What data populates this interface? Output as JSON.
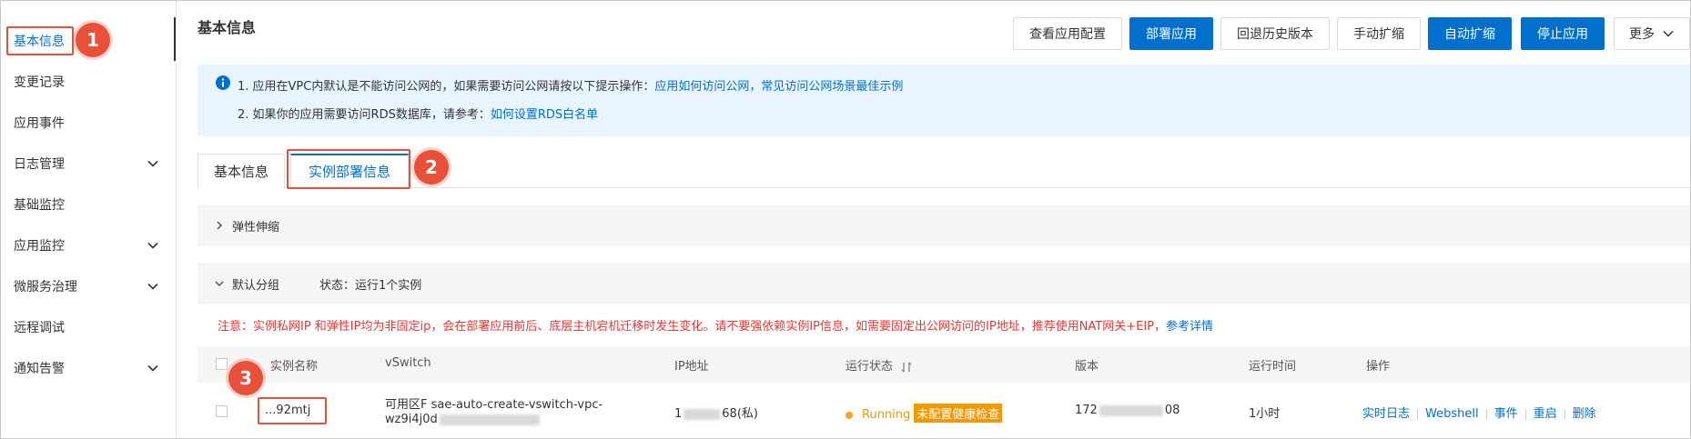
{
  "sidebar": {
    "items": [
      {
        "label": "基本信息",
        "expandable": false,
        "active": true
      },
      {
        "label": "变更记录",
        "expandable": false
      },
      {
        "label": "应用事件",
        "expandable": false
      },
      {
        "label": "日志管理",
        "expandable": true
      },
      {
        "label": "基础监控",
        "expandable": false
      },
      {
        "label": "应用监控",
        "expandable": true
      },
      {
        "label": "微服务治理",
        "expandable": true
      },
      {
        "label": "远程调试",
        "expandable": false
      },
      {
        "label": "通知告警",
        "expandable": true
      }
    ]
  },
  "header": {
    "title": "基本信息",
    "buttons": {
      "view_config": "查看应用配置",
      "deploy": "部署应用",
      "rollback": "回退历史版本",
      "manual_scale": "手动扩缩",
      "auto_scale": "自动扩缩",
      "stop": "停止应用",
      "more": "更多"
    }
  },
  "notice": {
    "line1_prefix": "1. 应用在VPC内默认是不能访问公网的，如果需要访问公网请按以下提示操作：",
    "line1_link1": "应用如何访问公网",
    "line1_sep": "，",
    "line1_link2": "常见访问公网场景最佳示例",
    "line2_prefix": "2. 如果你的应用需要访问RDS数据库，请参考：",
    "line2_link": "如何设置RDS白名单"
  },
  "tabs": [
    "基本信息",
    "实例部署信息"
  ],
  "elastic": {
    "label": "弹性伸缩"
  },
  "group": {
    "name": "默认分组",
    "status": "状态：运行1个实例"
  },
  "warning": {
    "text": "注意：实例私网IP 和弹性IP均为非固定ip，会在部署应用前后、底层主机宕机迁移时发生变化。请不要强依赖实例IP信息，如需要固定出公网访问的IP地址，推荐使用NAT网关+EIP，",
    "link": "参考详情"
  },
  "table": {
    "headers": {
      "name": "实例名称",
      "vswitch": "vSwitch",
      "ip": "IP地址",
      "status": "运行状态",
      "version": "版本",
      "uptime": "运行时间",
      "actions": "操作"
    },
    "row": {
      "name": "...92mtj",
      "vswitch_line1": "可用区F sae-auto-create-vswitch-vpc-",
      "vswitch_line2": "wz9i4j0d",
      "ip_prefix": "1",
      "ip_suffix": "68(私)",
      "status": "Running",
      "health_badge": "未配置健康检查",
      "version_prefix": "172",
      "version_suffix": "08",
      "uptime": "1小时",
      "actions": [
        "实时日志",
        "Webshell",
        "事件",
        "重启",
        "删除"
      ]
    }
  },
  "steps": [
    "1",
    "2",
    "3"
  ],
  "colors": {
    "accent": "#0070cc",
    "highlight": "#e8503a",
    "warning": "#e33333",
    "badge": "#f39800"
  }
}
